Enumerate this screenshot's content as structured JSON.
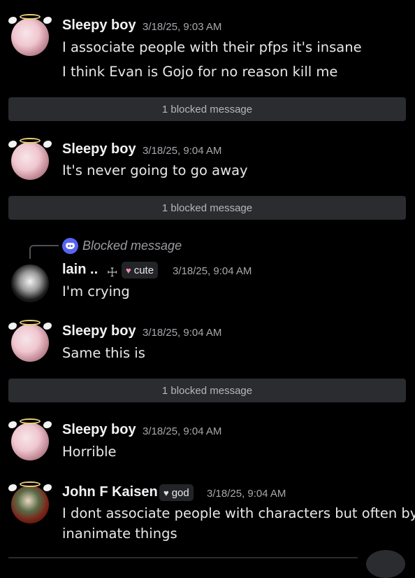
{
  "messages": [
    {
      "author": "Sleepy boy",
      "time": "3/18/25, 9:03 AM",
      "lines": [
        "I associate people with their pfps it's insane",
        "I think Evan is Gojo for no reason kill me"
      ]
    },
    {
      "author": "Sleepy boy",
      "time": "3/18/25, 9:04 AM",
      "lines": [
        "It's never going to go away"
      ]
    },
    {
      "author": "lain ..",
      "tag": "cute",
      "time": "3/18/25, 9:04 AM",
      "lines": [
        "I'm crying"
      ],
      "reply": "Blocked message"
    },
    {
      "author": "Sleepy boy",
      "time": "3/18/25, 9:04 AM",
      "lines": [
        "Same this is"
      ]
    },
    {
      "author": "Sleepy boy",
      "time": "3/18/25, 9:04 AM",
      "lines": [
        "Horrible"
      ]
    },
    {
      "author": "John F Kaisen",
      "tag": "god",
      "time": "3/18/25, 9:04 AM",
      "lines": [
        "I dont associate people with characters but often by",
        "inanimate things"
      ]
    }
  ],
  "blocked": [
    "1 blocked message",
    "1 blocked message",
    "1 blocked message"
  ],
  "icons": {
    "reply": "discord-icon",
    "tag_cute": "pink-heart-icon",
    "tag_god": "white-heart-icon",
    "cross": "cross-icon"
  },
  "colors": {
    "background": "#000000",
    "blocked_bar": "#2b2c30",
    "discord_blurple": "#5865f2",
    "halo": "#e9d07a"
  }
}
